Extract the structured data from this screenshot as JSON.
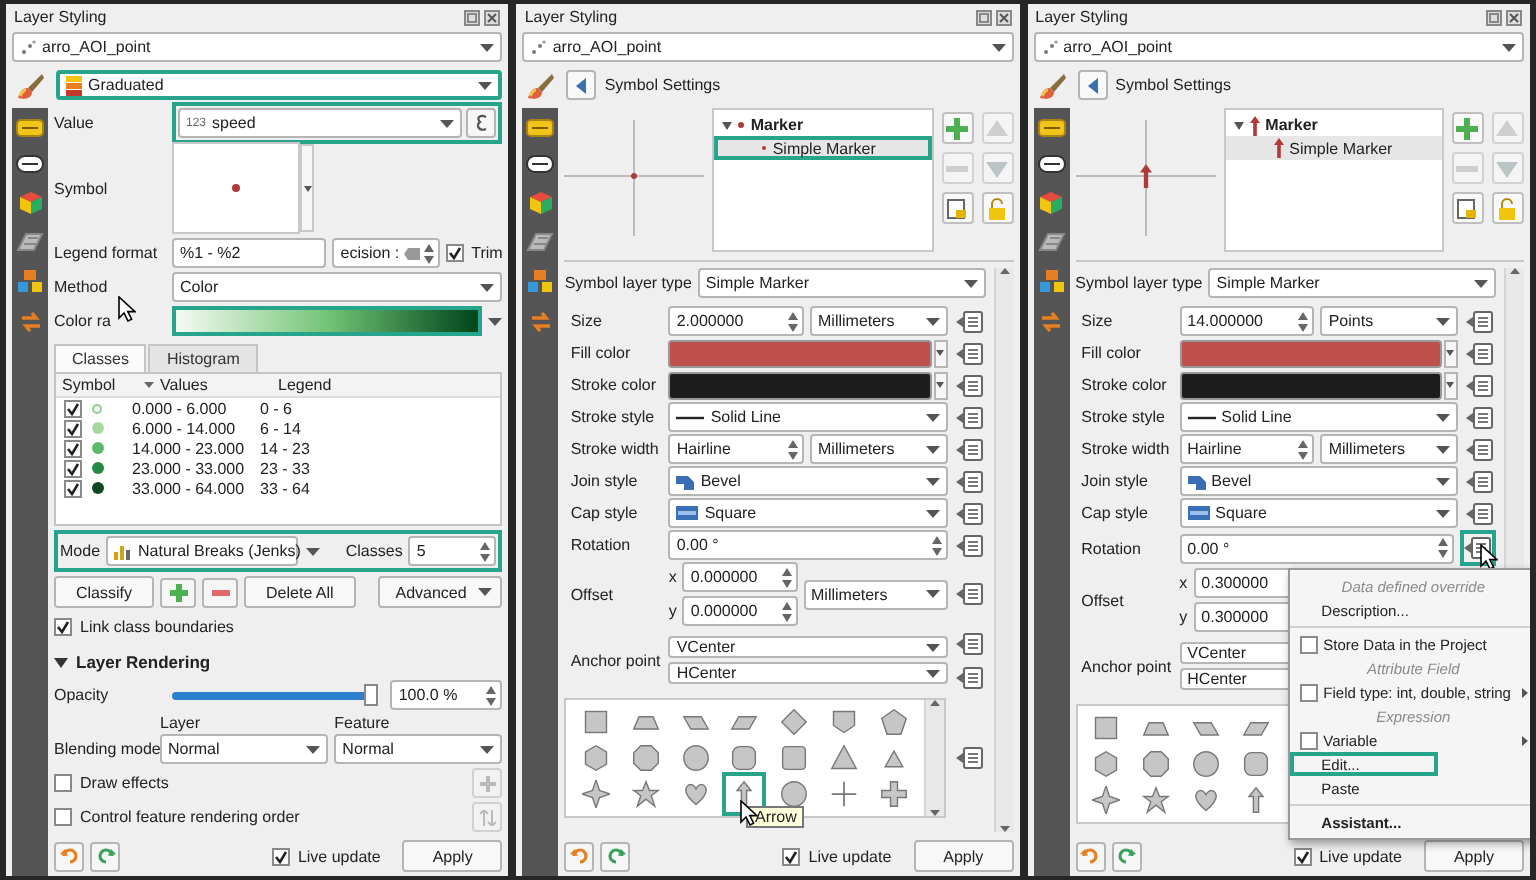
{
  "panels": [
    {
      "kind": "graduated",
      "title": "Layer Styling",
      "layer": "arro_AOI_point",
      "renderer": {
        "value": "Graduated",
        "highlighted": true
      },
      "value_row": {
        "label": "Value",
        "type_tag": "123",
        "field": "speed",
        "highlighted": true
      },
      "symbol_label": "Symbol",
      "legend_format": {
        "label": "Legend format",
        "value": "%1 - %2",
        "precision": "ecision :",
        "trim": {
          "label": "Trim",
          "checked": true
        }
      },
      "method": {
        "label": "Method",
        "value": "Color"
      },
      "color_ramp": {
        "label": "Color ra",
        "highlighted": true
      },
      "tabs": [
        {
          "label": "Classes",
          "selected": true
        },
        {
          "label": "Histogram",
          "selected": false
        }
      ],
      "columns": [
        "Symbol",
        "Values",
        "Legend"
      ],
      "classes": [
        {
          "checked": true,
          "color": "#eef7ec",
          "values": "0.000 - 6.000",
          "legend": "0 - 6"
        },
        {
          "checked": true,
          "color": "#a6d8a0",
          "values": "6.000 - 14.000",
          "legend": "6 - 14"
        },
        {
          "checked": true,
          "color": "#5cb86a",
          "values": "14.000 - 23.000",
          "legend": "14 - 23"
        },
        {
          "checked": true,
          "color": "#238b45",
          "values": "23.000 - 33.000",
          "legend": "23 - 33"
        },
        {
          "checked": true,
          "color": "#0b4a22",
          "values": "33.000 - 64.000",
          "legend": "33 - 64"
        }
      ],
      "mode": {
        "label": "Mode",
        "value": "Natural Breaks (Jenks)",
        "classes_label": "Classes",
        "classes_value": "5",
        "highlighted": true
      },
      "buttons": [
        {
          "kind": "text",
          "label": "Classify"
        },
        {
          "kind": "add"
        },
        {
          "kind": "remove"
        },
        {
          "kind": "text",
          "label": "Delete All"
        },
        {
          "kind": "menu",
          "label": "Advanced"
        }
      ],
      "link_boundaries": {
        "label": "Link class boundaries",
        "checked": true
      },
      "rendering": {
        "title": "Layer Rendering",
        "expanded": true,
        "opacity": {
          "label": "Opacity",
          "level": 1,
          "reading": "100.0 %"
        },
        "blending": {
          "label": "Blending mode",
          "layer_label": "Layer",
          "layer_value": "Normal",
          "feature_label": "Feature",
          "feature_value": "Normal"
        },
        "options": [
          {
            "label": "Draw effects",
            "checked": false
          },
          {
            "label": "Control feature rendering order",
            "checked": false
          }
        ]
      },
      "footer": {
        "live_update": {
          "label": "Live update",
          "checked": true
        },
        "apply": "Apply"
      }
    },
    {
      "kind": "symbol",
      "title": "Layer Styling",
      "layer": "arro_AOI_point",
      "header": "Symbol Settings",
      "preview": {
        "kind": "dot"
      },
      "tree": {
        "label": "Marker",
        "expanded": true,
        "children": [
          {
            "label": "Simple Marker",
            "selected": true,
            "highlighted": true
          }
        ]
      },
      "layer_type": {
        "label": "Symbol layer type",
        "value": "Simple Marker"
      },
      "properties": [
        {
          "kind": "spin_unit",
          "label": "Size",
          "value": "2.000000",
          "unit": "Millimeters"
        },
        {
          "kind": "color",
          "label": "Fill color",
          "color": "#c0504d"
        },
        {
          "kind": "color",
          "label": "Stroke color",
          "color": "#1c1c1c"
        },
        {
          "kind": "line_style",
          "label": "Stroke style",
          "value": "Solid Line"
        },
        {
          "kind": "spin_unit",
          "label": "Stroke width",
          "value": "Hairline",
          "unit": "Millimeters"
        },
        {
          "kind": "join_style",
          "label": "Join style",
          "value": "Bevel"
        },
        {
          "kind": "cap_style",
          "label": "Cap style",
          "value": "Square"
        },
        {
          "kind": "spin",
          "label": "Rotation",
          "value": "0.00 °",
          "override_highlighted": false
        },
        {
          "kind": "offset",
          "label": "Offset",
          "axes": [
            {
              "label": "x",
              "value": "0.000000"
            },
            {
              "label": "y",
              "value": "0.000000"
            }
          ],
          "unit": "Millimeters"
        },
        {
          "kind": "anchor",
          "label": "Anchor point",
          "vertical": "VCenter",
          "horizontal": "HCenter"
        }
      ],
      "gallery": {
        "highlighted_shape": {
          "kind": "arrow",
          "tooltip": "Arrow"
        }
      },
      "footer": {
        "live_update": {
          "label": "Live update",
          "checked": true
        },
        "apply": "Apply"
      }
    },
    {
      "kind": "symbol",
      "title": "Layer Styling",
      "layer": "arro_AOI_point",
      "header": "Symbol Settings",
      "preview": {
        "kind": "arrow"
      },
      "tree": {
        "label": "Marker",
        "expanded": true,
        "children": [
          {
            "label": "Simple Marker",
            "selected": true,
            "highlighted": false
          }
        ]
      },
      "layer_type": {
        "label": "Symbol layer type",
        "value": "Simple Marker"
      },
      "properties": [
        {
          "kind": "spin_unit",
          "label": "Size",
          "value": "14.000000",
          "unit": "Points"
        },
        {
          "kind": "color",
          "label": "Fill color",
          "color": "#c0504d"
        },
        {
          "kind": "color",
          "label": "Stroke color",
          "color": "#1c1c1c"
        },
        {
          "kind": "line_style",
          "label": "Stroke style",
          "value": "Solid Line"
        },
        {
          "kind": "spin_unit",
          "label": "Stroke width",
          "value": "Hairline",
          "unit": "Millimeters"
        },
        {
          "kind": "join_style",
          "label": "Join style",
          "value": "Bevel"
        },
        {
          "kind": "cap_style",
          "label": "Cap style",
          "value": "Square"
        },
        {
          "kind": "spin",
          "label": "Rotation",
          "value": "0.00 °",
          "override_highlighted": true
        },
        {
          "kind": "offset",
          "label": "Offset",
          "axes": [
            {
              "label": "x",
              "value": "0.300000"
            },
            {
              "label": "y",
              "value": "0.300000"
            }
          ]
        },
        {
          "kind": "anchor",
          "label": "Anchor point",
          "vertical": "VCenter",
          "horizontal": "HCenter"
        }
      ],
      "menu": [
        {
          "kind": "header",
          "text": "Data defined override"
        },
        {
          "kind": "item",
          "text": "Description...",
          "bold": false,
          "highlighted": false
        },
        {
          "kind": "separator"
        },
        {
          "kind": "check",
          "text": "Store Data in the Project",
          "checked": false,
          "submenu": false
        },
        {
          "kind": "header",
          "text": "Attribute Field"
        },
        {
          "kind": "check",
          "text": "Field type: int, double, string",
          "checked": false,
          "submenu": true
        },
        {
          "kind": "header",
          "text": "Expression"
        },
        {
          "kind": "check",
          "text": "Variable",
          "checked": false,
          "submenu": true
        },
        {
          "kind": "item",
          "text": "Edit...",
          "bold": false,
          "highlighted": true
        },
        {
          "kind": "item",
          "text": "Paste",
          "bold": false,
          "highlighted": false
        },
        {
          "kind": "separator"
        },
        {
          "kind": "item",
          "text": "Assistant...",
          "bold": true,
          "highlighted": false
        }
      ],
      "footer": {
        "live_update": {
          "label": "Live update",
          "checked": true
        },
        "apply": "Apply"
      }
    }
  ]
}
